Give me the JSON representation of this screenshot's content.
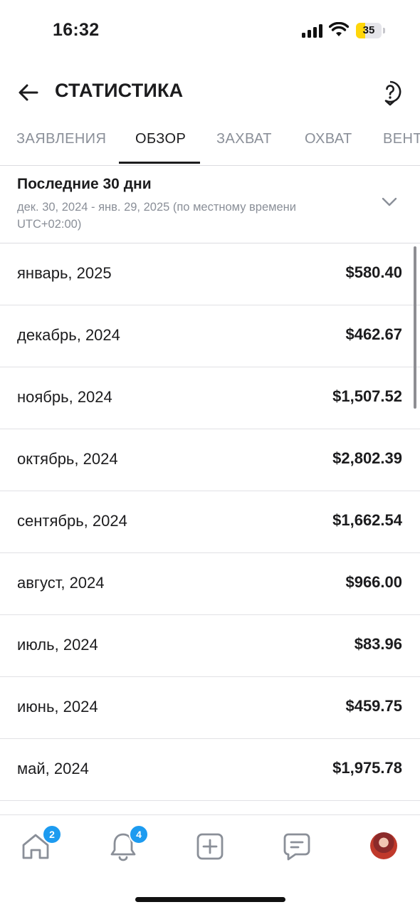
{
  "status_bar": {
    "time": "16:32",
    "battery": "35"
  },
  "header": {
    "title": "СТАТИСТИКА"
  },
  "tabs": [
    {
      "label": "ЗАЯВЛЕНИЯ",
      "active": false
    },
    {
      "label": "ОБЗОР",
      "active": true
    },
    {
      "label": "ЗАХВАТ",
      "active": false
    },
    {
      "label": "ОХВАТ",
      "active": false
    },
    {
      "label": "ВЕНТ",
      "active": false
    }
  ],
  "period": {
    "title": "Последние 30 дни",
    "subtitle": "дек. 30, 2024 - янв. 29, 2025 (по местному времени UTC+02:00)"
  },
  "earnings": [
    {
      "month": "январь, 2025",
      "amount": "$580.40"
    },
    {
      "month": "декабрь, 2024",
      "amount": "$462.67"
    },
    {
      "month": "ноябрь, 2024",
      "amount": "$1,507.52"
    },
    {
      "month": "октябрь, 2024",
      "amount": "$2,802.39"
    },
    {
      "month": "сентябрь, 2024",
      "amount": "$1,662.54"
    },
    {
      "month": "август, 2024",
      "amount": "$966.00"
    },
    {
      "month": "июль, 2024",
      "amount": "$83.96"
    },
    {
      "month": "июнь, 2024",
      "amount": "$459.75"
    },
    {
      "month": "май, 2024",
      "amount": "$1,975.78"
    }
  ],
  "bottom_nav": {
    "home_badge": "2",
    "notifications_badge": "4",
    "items": [
      "home-icon",
      "bell-icon",
      "plus-square-icon",
      "chat-icon",
      "avatar"
    ]
  },
  "colors": {
    "accent_badge": "#1d9bf0",
    "text_primary": "#1c1c1e",
    "text_secondary": "#8a8f98"
  }
}
